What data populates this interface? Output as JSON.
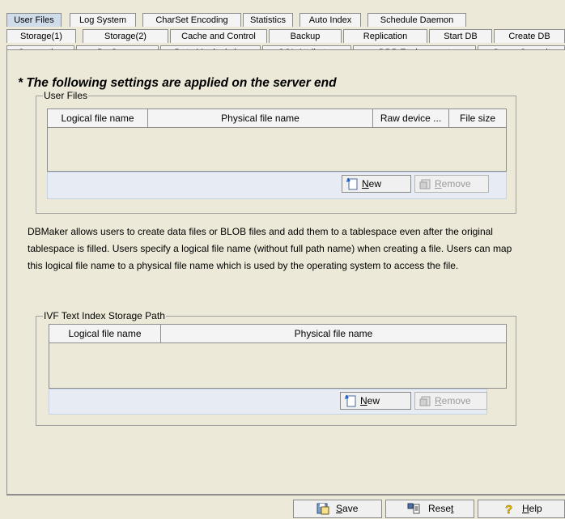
{
  "tabs": {
    "row1": [
      "User Files",
      "Log System",
      "CharSet Encoding",
      "Statistics",
      "Auto Index",
      "Schedule Daemon"
    ],
    "row2": [
      "Storage(1)",
      "Storage(2)",
      "Cache and Control",
      "Backup",
      "Replication",
      "Start DB",
      "Create DB"
    ],
    "row3": [
      "Connection",
      "DmServer",
      "Data Manipulation",
      "SQL Attributes",
      "DDB Environment",
      "Group Commit"
    ]
  },
  "heading": "* The following settings are applied on the server end",
  "user_files": {
    "legend": "User Files",
    "columns": [
      "Logical file name",
      "Physical file name",
      "Raw device ...",
      "File size"
    ],
    "new_label_pre": "",
    "new_label_ul": "N",
    "new_label_post": "ew",
    "remove_label_pre": "",
    "remove_label_ul": "R",
    "remove_label_post": "emove"
  },
  "description": "DBMaker allows users to create data files or BLOB files and add them to a tablespace even after the original tablespace is filled. Users specify a logical file name (without full path name) when creating a  file. Users can map this logical file name to a physical file name which is used by the operating system to access the file.",
  "ivf": {
    "legend": "IVF Text Index Storage Path",
    "columns": [
      "Logical file name",
      "Physical file name"
    ],
    "new_label_pre": "",
    "new_label_ul": "N",
    "new_label_post": "ew",
    "remove_label_pre": "",
    "remove_label_ul": "R",
    "remove_label_post": "emove"
  },
  "bottom": {
    "save_pre": "",
    "save_ul": "S",
    "save_post": "ave",
    "reset_pre": "Rese",
    "reset_ul": "t",
    "reset_post": "",
    "help_pre": "",
    "help_ul": "H",
    "help_post": "elp"
  }
}
